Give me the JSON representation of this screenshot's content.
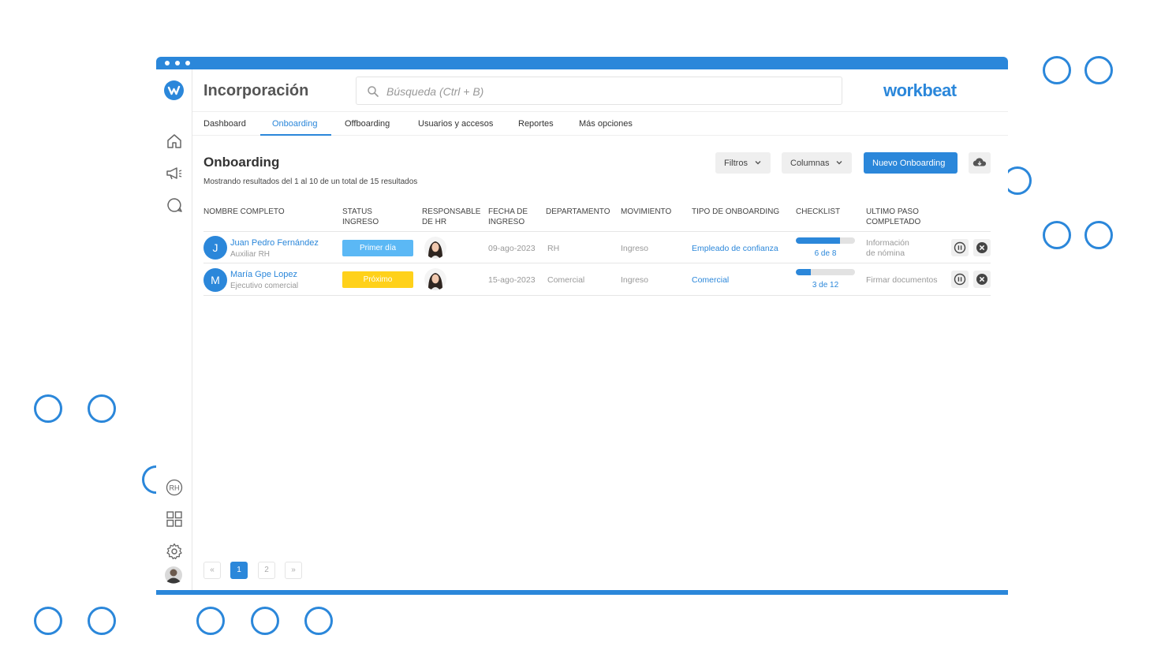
{
  "app": {
    "title": "Incorporación",
    "brand": "workbeat"
  },
  "search": {
    "placeholder": "Búsqueda (Ctrl + B)"
  },
  "tabs": [
    {
      "label": "Dashboard"
    },
    {
      "label": "Onboarding",
      "active": true
    },
    {
      "label": "Offboarding"
    },
    {
      "label": "Usuarios y accesos"
    },
    {
      "label": "Reportes"
    },
    {
      "label": "Más opciones"
    }
  ],
  "sidebar": {
    "top_icons": [
      "home-icon",
      "megaphone-icon",
      "chat-icon"
    ],
    "bottom_icons": [
      "rh-icon",
      "grid-icon",
      "gear-icon",
      "user-avatar"
    ],
    "rh_label": "RH"
  },
  "main": {
    "title": "Onboarding",
    "subtitle": "Mostrando resultados del 1 al 10 de un total de 15 resultados",
    "filters_label": "Filtros",
    "columns_label": "Columnas",
    "new_button_label": "Nuevo Onboarding",
    "download_icon": "cloud-download-icon"
  },
  "table": {
    "headers": [
      "NOMBRE COMPLETO",
      "STATUS INGRESO",
      "RESPONSABLE DE HR",
      "FECHA DE INGRESO",
      "DEPARTAMENTO",
      "MOVIMIENTO",
      "TIPO DE ONBOARDING",
      "CHECKLIST",
      "ULTIMO PASO COMPLETADO"
    ],
    "header_lines": [
      [
        "NOMBRE COMPLETO"
      ],
      [
        "STATUS",
        "INGRESO"
      ],
      [
        "RESPONSABLE",
        "DE HR"
      ],
      [
        "FECHA DE",
        "INGRESO"
      ],
      [
        "DEPARTAMENTO"
      ],
      [
        "MOVIMIENTO"
      ],
      [
        "TIPO DE ONBOARDING"
      ],
      [
        "CHECKLIST"
      ],
      [
        "ULTIMO PASO",
        "COMPLETADO"
      ]
    ],
    "rows": [
      {
        "initial": "J",
        "name": "Juan Pedro Fernández",
        "role": "Auxiliar RH",
        "status": "Primer día",
        "status_color": "#5bb8f5",
        "date": "09-ago-2023",
        "department": "RH",
        "movement": "Ingreso",
        "onboarding_type": "Empleado de confianza",
        "checklist_done": 6,
        "checklist_total": 8,
        "checklist_label": "6 de 8",
        "last_step": "Información de nómina",
        "last_step_lines": [
          "Información",
          "de nómina"
        ]
      },
      {
        "initial": "M",
        "name": "María Gpe Lopez",
        "role": "Ejecutivo comercial",
        "status": "Próximo",
        "status_color": "#ffd11a",
        "date": "15-ago-2023",
        "department": "Comercial",
        "movement": "Ingreso",
        "onboarding_type": "Comercial",
        "checklist_done": 3,
        "checklist_total": 12,
        "checklist_label": "3 de 12",
        "last_step": "Firmar documentos",
        "last_step_lines": [
          "Firmar documentos"
        ]
      }
    ]
  },
  "pagination": {
    "first": "«",
    "pages": [
      "1",
      "2"
    ],
    "current": "1",
    "last": "»"
  },
  "colors": {
    "accent": "#2b87da",
    "status_first_day": "#5bb8f5",
    "status_upcoming": "#ffd11a"
  }
}
